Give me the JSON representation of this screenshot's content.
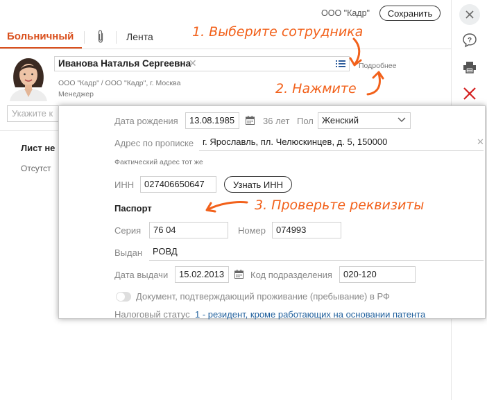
{
  "header": {
    "org_name": "ООО \"Кадр\"",
    "save_label": "Сохранить"
  },
  "tabs": {
    "sick_leave": "Больничный",
    "feed": "Лента"
  },
  "employee": {
    "name": "Иванова Наталья Сергеевна",
    "more_link": "Подробнее",
    "org": "ООО \"Кадр\" / ООО \"Кадр\", г. Москва",
    "position": "Менеджер"
  },
  "background": {
    "input_placeholder": "Укажите к",
    "heading": "Лист не",
    "subtext": "Отсутст"
  },
  "details": {
    "birth_label": "Дата рождения",
    "birth_value": "13.08.1985",
    "age": "36 лет",
    "gender_label": "Пол",
    "gender_value": "Женский",
    "address_label": "Адрес по прописке",
    "address_value": "г. Ярославль, пл. Челюскинцев, д. 5, 150000",
    "actual_address_note": "Фактический адрес тот же",
    "inn_label": "ИНН",
    "inn_value": "027406650647",
    "inn_button": "Узнать ИНН",
    "passport_heading": "Паспорт",
    "series_label": "Серия",
    "series_value": "76 04",
    "number_label": "Номер",
    "number_value": "074993",
    "issued_label": "Выдан",
    "issued_value": "РОВД",
    "issue_date_label": "Дата выдачи",
    "issue_date_value": "15.02.2013",
    "dept_code_label": "Код подразделения",
    "dept_code_value": "020-120",
    "residence_doc_label": "Документ, подтверждающий проживание (пребывание) в РФ",
    "tax_status_label": "Налоговый статус",
    "tax_status_value": "1 - резидент, кроме работающих на основании патента"
  },
  "annotations": {
    "step1": "1. Выберите сотрудника",
    "step2": "2. Нажмите",
    "step3": "3. Проверьте реквизиты"
  },
  "colors": {
    "accent": "#d9501e",
    "annotation": "#f2611b",
    "link": "#1f5f9c"
  },
  "icons": [
    "close-icon",
    "help-icon",
    "print-icon",
    "delete-icon",
    "paperclip-icon",
    "list-icon",
    "calendar-icon",
    "chevron-down-icon"
  ]
}
